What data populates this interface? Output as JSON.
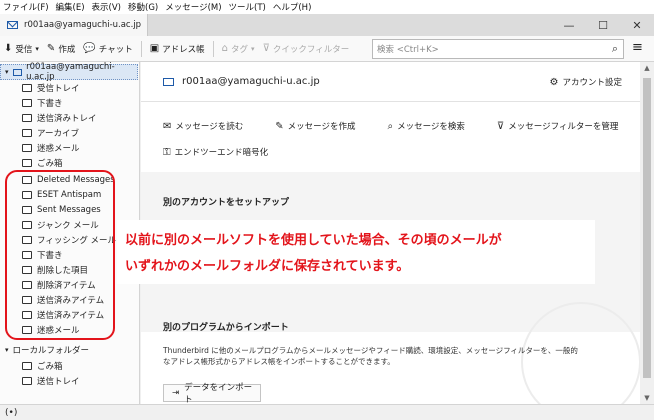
{
  "menubar": [
    "ファイル(F)",
    "編集(E)",
    "表示(V)",
    "移動(G)",
    "メッセージ(M)",
    "ツール(T)",
    "ヘルプ(H)"
  ],
  "tab": {
    "title": "r001aa@yamaguchi-u.ac.jp"
  },
  "window_controls": [
    "—",
    "☐",
    "✕"
  ],
  "toolbar": {
    "receive": "受信",
    "compose": "作成",
    "chat": "チャット",
    "address_book": "アドレス帳",
    "tag": "タグ",
    "quick_filter": "クイックフィルター",
    "search_placeholder": "検索 <Ctrl+K>"
  },
  "sidebar": {
    "account": "r001aa@yamaguchi-u.ac.jp",
    "folders": [
      "受信トレイ",
      "下書き",
      "送信済みトレイ",
      "アーカイブ",
      "迷惑メール",
      "ごみ箱"
    ],
    "highlighted_folders": [
      "Deleted Messages",
      "ESET Antispam",
      "Sent Messages",
      "ジャンク メール",
      "フィッシング メール",
      "下書き",
      "削除した項目",
      "削除済アイテム",
      "送信済みアイテム",
      "送信済みアイテム",
      "迷惑メール"
    ],
    "local_folders": "ローカルフォルダー",
    "local_items": [
      "ごみ箱",
      "送信トレイ"
    ]
  },
  "main": {
    "account_address": "r001aa@yamaguchi-u.ac.jp",
    "account_settings": "アカウント設定",
    "actions": [
      "メッセージを読む",
      "メッセージを作成",
      "メッセージを検索",
      "メッセージフィルターを管理"
    ],
    "e2e": "エンドツーエンド暗号化",
    "setup_heading": "別のアカウントをセットアップ",
    "import_heading": "別のプログラムからインポート",
    "import_text": "Thunderbird に他のメールプログラムからメールメッセージやフィード購読、環境設定、メッセージフィルターを、一般的なアドレス帳形式からアドレス帳をインポートすることができます。",
    "import_button": "データをインポート"
  },
  "callout": {
    "line1": "以前に別のメールソフトを使用していた場合、その頃のメールが",
    "line2": "いずれかのメールフォルダに保存されています。"
  },
  "status_icon": "(•)",
  "colors": {
    "accent": "#1e5aa8",
    "annotation": "#e3141b",
    "selection": "#dbe7f5"
  }
}
